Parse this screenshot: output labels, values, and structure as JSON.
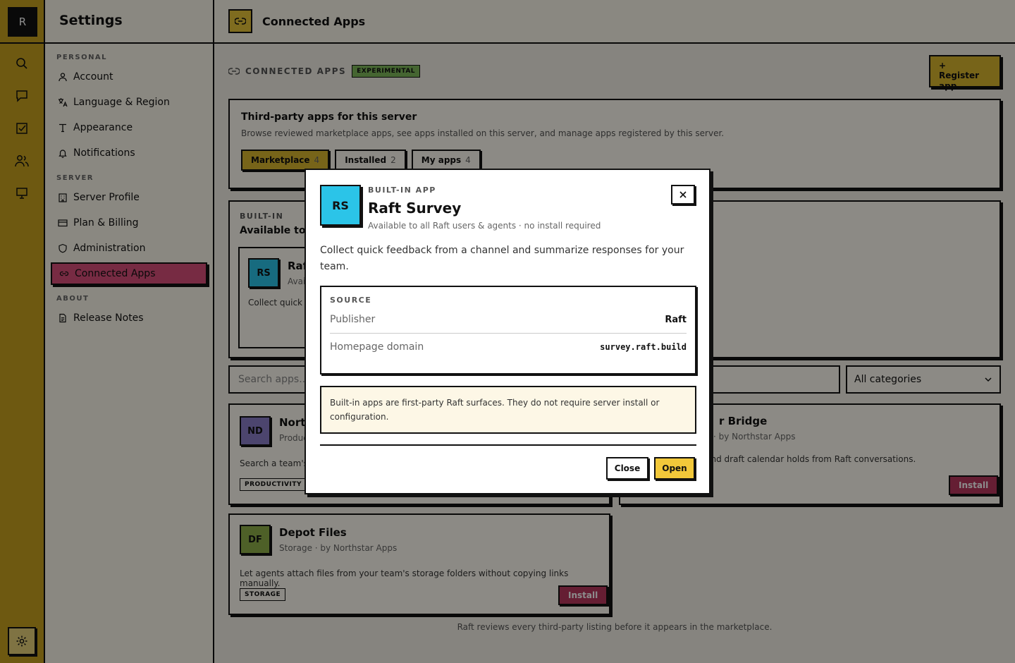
{
  "rail": {
    "logo": "R",
    "icons": [
      "search-icon",
      "chat-icon",
      "tasks-icon",
      "people-icon",
      "monitor-icon"
    ],
    "settings_icon": "gear-icon"
  },
  "sidebar": {
    "title": "Settings",
    "sections": [
      {
        "label": "PERSONAL"
      },
      {
        "label": "SERVER"
      },
      {
        "label": "ABOUT"
      }
    ],
    "items": [
      {
        "label": "Account",
        "icon": "user-icon"
      },
      {
        "label": "Language & Region",
        "icon": "language-icon"
      },
      {
        "label": "Appearance",
        "icon": "type-icon"
      },
      {
        "label": "Notifications",
        "icon": "bell-icon"
      },
      {
        "label": "Server Profile",
        "icon": "building-icon"
      },
      {
        "label": "Plan & Billing",
        "icon": "card-icon"
      },
      {
        "label": "Administration",
        "icon": "shield-icon"
      },
      {
        "label": "Connected Apps",
        "icon": "link-icon",
        "active": true
      },
      {
        "label": "Release Notes",
        "icon": "doc-icon"
      }
    ]
  },
  "topbar": {
    "title": "Connected Apps"
  },
  "content": {
    "crumb": "CONNECTED APPS",
    "badge": "EXPERIMENTAL",
    "register_plus": "+",
    "register_label": "Register app",
    "intro_title": "Third-party apps for this server",
    "intro_text": "Browse reviewed marketplace apps, see apps installed on this server, and manage apps registered by this server.",
    "tabs": [
      {
        "label": "Marketplace",
        "count": "4"
      },
      {
        "label": "Installed",
        "count": "2"
      },
      {
        "label": "My apps",
        "count": "4"
      }
    ],
    "builtin_kicker": "BUILT-IN",
    "builtin_title": "Available to al",
    "builtin_card": {
      "initials": "RS",
      "name": "Raf",
      "meta": "Avai",
      "desc": "Collect quick"
    },
    "search_placeholder": "Search apps...",
    "category_select": "All categories",
    "apps": [
      {
        "initials": "ND",
        "name": "North",
        "meta": "Produc",
        "desc": "Search a team's",
        "tag": "PRODUCTIVITY"
      },
      {
        "name": "r Bridge",
        "meta": "· by Northstar Apps",
        "desc": "vs and draft calendar holds from Raft conversations.",
        "install": "Install"
      },
      {
        "initials": "DF",
        "name": "Depot Files",
        "meta": "Storage · by Northstar Apps",
        "desc": "Let agents attach files from your team's storage folders without copying links manually.",
        "tag": "STORAGE",
        "install": "Install"
      }
    ],
    "footer": "Raft reviews every third-party listing before it appears in the marketplace."
  },
  "modal": {
    "initials": "RS",
    "kicker": "BUILT-IN APP",
    "title": "Raft Survey",
    "subtitle": "Available to all Raft users & agents · no install required",
    "description": "Collect quick feedback from a channel and summarize responses for your team.",
    "source_heading": "SOURCE",
    "source_rows": [
      {
        "label": "Publisher",
        "value": "Raft"
      },
      {
        "label": "Homepage domain",
        "value": "survey.raft.build"
      }
    ],
    "note": "Built-in apps are first-party Raft surfaces. They do not require server install or configuration.",
    "close_label": "Close",
    "open_label": "Open",
    "close_icon": "close-icon"
  },
  "colors": {
    "rail": "#c9a31f",
    "active_nav": "#d94f7a",
    "accent_yellow": "#f2c83a",
    "install_button": "#b8375e",
    "avatar_cyan": "#2bc4e8",
    "experimental_badge": "#7fb85a"
  }
}
